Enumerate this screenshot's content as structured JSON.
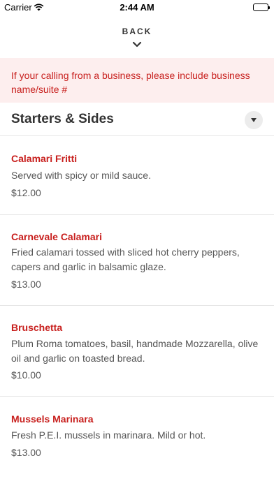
{
  "status_bar": {
    "carrier": "Carrier",
    "time": "2:44 AM",
    "wifi_icon": "wifi-icon",
    "battery_icon": "battery-icon"
  },
  "nav": {
    "back_label": "BACK",
    "back_icon": "chevron-down-icon"
  },
  "alert": {
    "text": "If your calling from a business, please include business name/suite #"
  },
  "section": {
    "title": "Starters & Sides",
    "toggle_icon": "caret-down-icon"
  },
  "items": [
    {
      "name": "Calamari Fritti",
      "description": "Served with spicy or mild sauce.",
      "price": "$12.00"
    },
    {
      "name": "Carnevale Calamari",
      "description": "Fried calamari tossed with sliced hot cherry peppers, capers and garlic in balsamic glaze.",
      "price": "$13.00"
    },
    {
      "name": "Bruschetta",
      "description": "Plum Roma tomatoes, basil, handmade Mozzarella, olive oil and garlic on toasted bread.",
      "price": "$10.00"
    },
    {
      "name": "Mussels Marinara",
      "description": "Fresh P.E.I. mussels in marinara. Mild or hot.",
      "price": "$13.00"
    }
  ],
  "colors": {
    "accent": "#c8201e",
    "alert_bg": "#fdeeee",
    "divider": "#e6e6e6"
  }
}
